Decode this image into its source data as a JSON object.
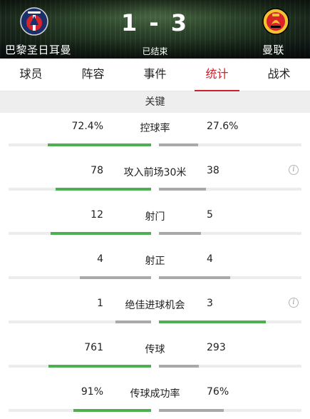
{
  "match": {
    "home_team": "巴黎圣日耳曼",
    "away_team": "曼联",
    "score": "1 - 3",
    "status": "已结束"
  },
  "tabs": [
    {
      "label": "球员",
      "active": false
    },
    {
      "label": "阵容",
      "active": false
    },
    {
      "label": "事件",
      "active": false
    },
    {
      "label": "统计",
      "active": true
    },
    {
      "label": "战术",
      "active": false
    }
  ],
  "section": {
    "title": "关键"
  },
  "colors": {
    "accent": "#d0202c",
    "leading": "#4caf50",
    "trailing": "#a9a9a9",
    "track": "#ececec"
  },
  "stats": [
    {
      "label": "控球率",
      "home": "72.4%",
      "away": "27.6%",
      "home_share": 0.724,
      "away_share": 0.276,
      "home_leads": true,
      "away_leads": false,
      "info": false
    },
    {
      "label": "攻入前场30米",
      "home": "78",
      "away": "38",
      "home_share": 0.672,
      "away_share": 0.328,
      "home_leads": true,
      "away_leads": false,
      "info": true
    },
    {
      "label": "射门",
      "home": "12",
      "away": "5",
      "home_share": 0.706,
      "away_share": 0.294,
      "home_leads": true,
      "away_leads": false,
      "info": false
    },
    {
      "label": "射正",
      "home": "4",
      "away": "4",
      "home_share": 0.5,
      "away_share": 0.5,
      "home_leads": false,
      "away_leads": false,
      "info": false
    },
    {
      "label": "绝佳进球机会",
      "home": "1",
      "away": "3",
      "home_share": 0.25,
      "away_share": 0.75,
      "home_leads": false,
      "away_leads": true,
      "info": true
    },
    {
      "label": "传球",
      "home": "761",
      "away": "293",
      "home_share": 0.722,
      "away_share": 0.278,
      "home_leads": true,
      "away_leads": false,
      "info": false
    },
    {
      "label": "传球成功率",
      "home": "91%",
      "away": "76%",
      "home_share": 0.545,
      "away_share": 0.455,
      "home_leads": true,
      "away_leads": false,
      "info": false
    }
  ]
}
